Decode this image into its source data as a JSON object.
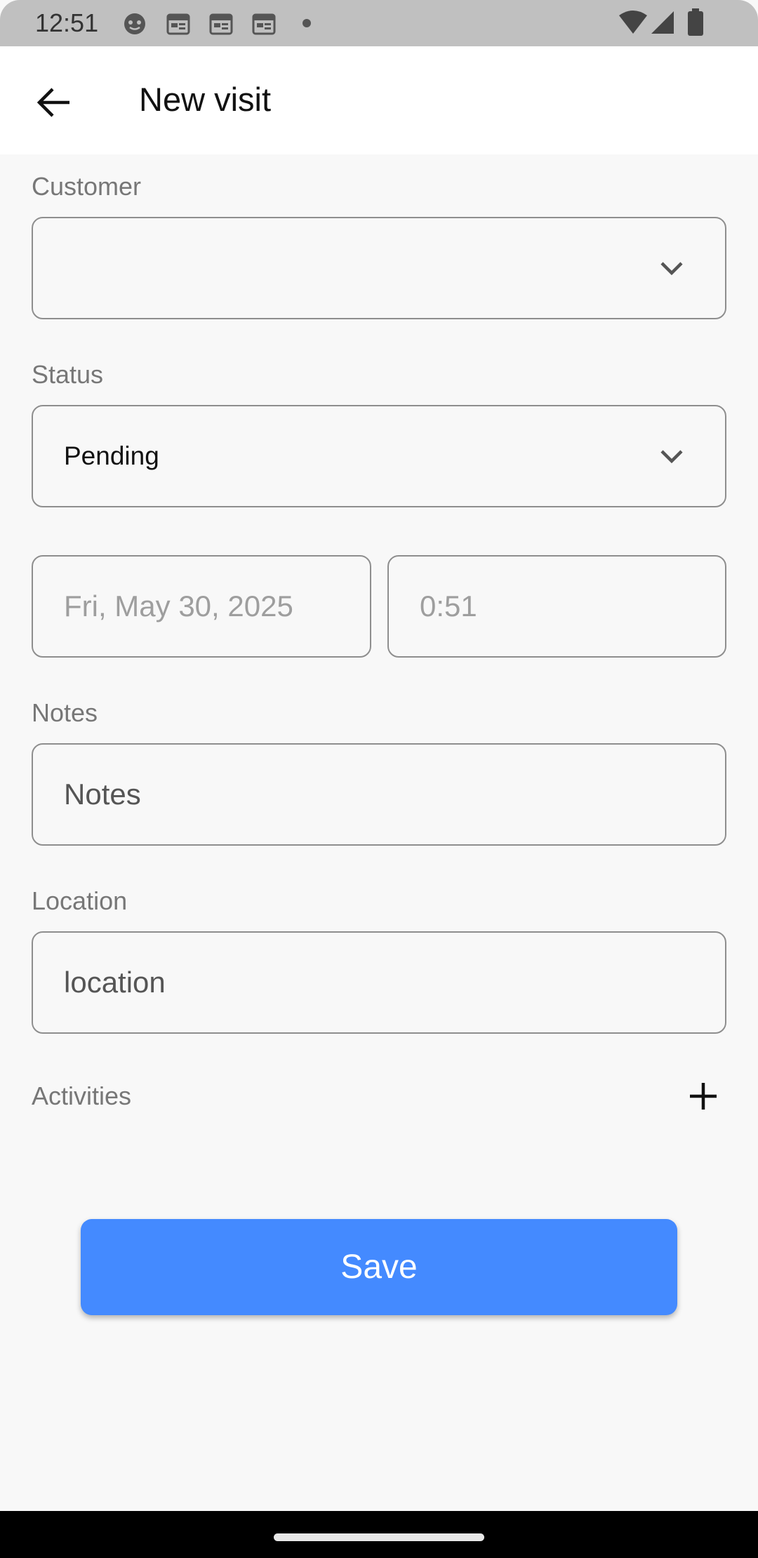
{
  "status_bar": {
    "time": "12:51",
    "icons": [
      "face-notification-icon",
      "calendar-icon",
      "calendar-icon",
      "calendar-icon",
      "dot-icon",
      "wifi-icon",
      "signal-icon",
      "battery-icon"
    ]
  },
  "app_bar": {
    "title": "New visit",
    "back_icon": "arrow-back-icon"
  },
  "form": {
    "customer": {
      "label": "Customer",
      "value": ""
    },
    "status": {
      "label": "Status",
      "value": "Pending"
    },
    "date": {
      "value": "Fri, May 30, 2025"
    },
    "time": {
      "value": "0:51"
    },
    "notes": {
      "label": "Notes",
      "placeholder": "Notes"
    },
    "location": {
      "label": "Location",
      "placeholder": "location"
    },
    "activities": {
      "label": "Activities",
      "add_icon": "plus-icon"
    }
  },
  "save_button": {
    "label": "Save"
  },
  "colors": {
    "accent": "#448aff",
    "status_bar": "#c0c0c0",
    "background": "#f8f8f8"
  }
}
